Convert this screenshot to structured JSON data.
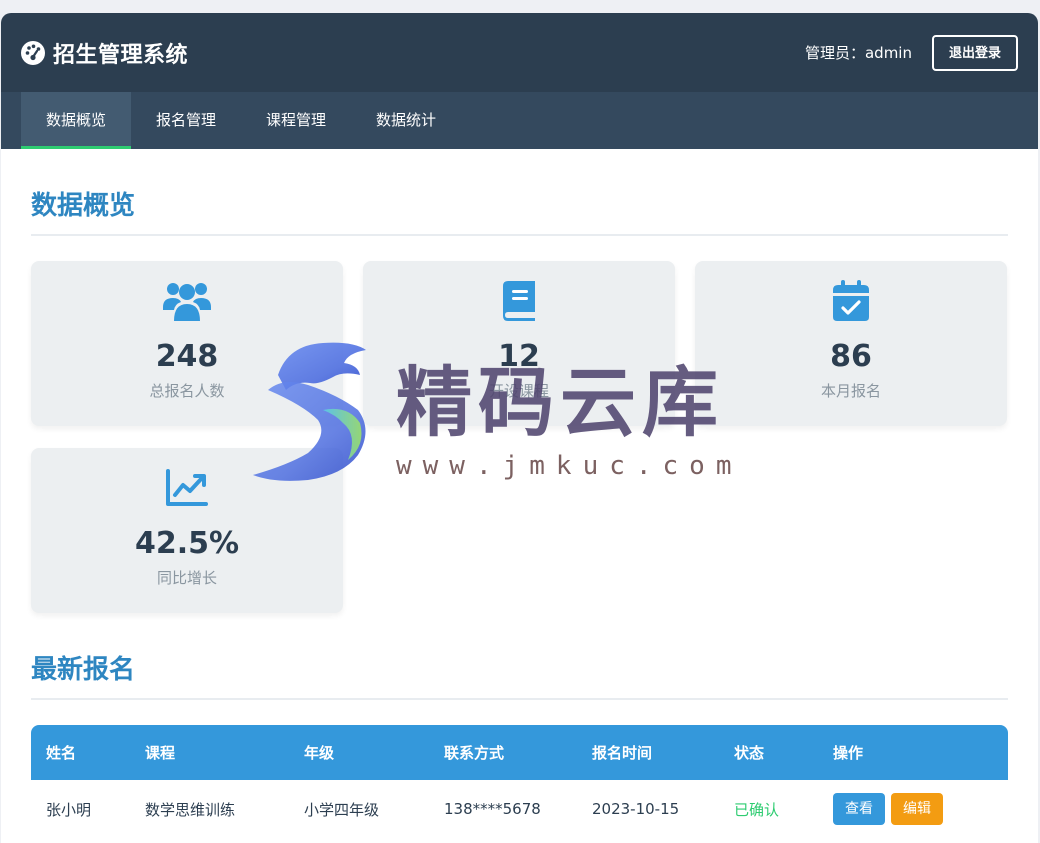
{
  "header": {
    "title": "招生管理系统",
    "user_label": "管理员：admin",
    "logout_label": "退出登录"
  },
  "nav": {
    "tabs": [
      {
        "label": "数据概览",
        "active": true
      },
      {
        "label": "报名管理",
        "active": false
      },
      {
        "label": "课程管理",
        "active": false
      },
      {
        "label": "数据统计",
        "active": false
      }
    ]
  },
  "overview": {
    "title": "数据概览",
    "cards": [
      {
        "icon": "users-icon",
        "value": "248",
        "label": "总报名人数"
      },
      {
        "icon": "book-icon",
        "value": "12",
        "label": "开设课程"
      },
      {
        "icon": "calendar-check-icon",
        "value": "86",
        "label": "本月报名"
      },
      {
        "icon": "chart-line-icon",
        "value": "42.5%",
        "label": "同比增长"
      }
    ]
  },
  "latest": {
    "title": "最新报名",
    "columns": [
      "姓名",
      "课程",
      "年级",
      "联系方式",
      "报名时间",
      "状态",
      "操作"
    ],
    "rows": [
      {
        "name": "张小明",
        "course": "数学思维训练",
        "grade": "小学四年级",
        "contact": "138****5678",
        "date": "2023-10-15",
        "status": "已确认",
        "view_label": "查看",
        "edit_label": "编辑"
      }
    ]
  },
  "watermark": {
    "text": "精码云库",
    "url": "www.jmkuc.com"
  },
  "colors": {
    "topbar": "#2c3e50",
    "navbar": "#34495e",
    "accent": "#3498db",
    "title": "#2e86c1",
    "success": "#2ecc71",
    "warning": "#f39c12"
  }
}
